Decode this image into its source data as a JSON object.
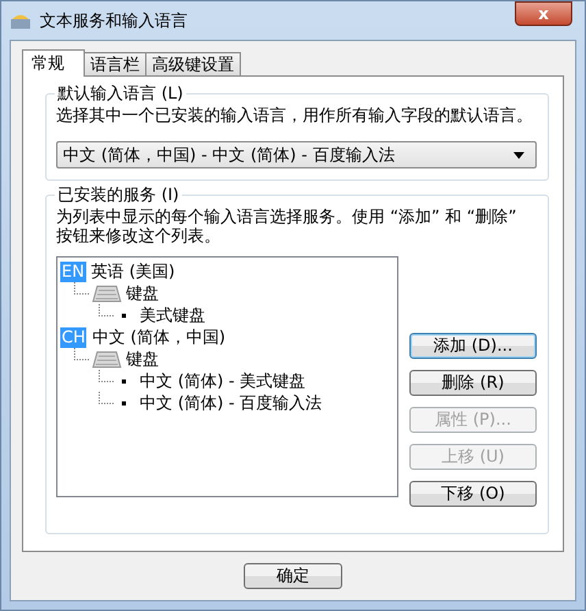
{
  "window": {
    "title": "文本服务和输入语言",
    "close_label": "x"
  },
  "tabs": [
    {
      "label": "常规",
      "selected": true
    },
    {
      "label": "语言栏",
      "selected": false
    },
    {
      "label": "高级键设置",
      "selected": false
    }
  ],
  "default_language": {
    "legend": "默认输入语言 (L)",
    "description": "选择其中一个已安装的输入语言，用作所有输入字段的默认语言。",
    "value": "中文 (简体，中国) - 中文 (简体) - 百度输入法"
  },
  "installed_services": {
    "legend": "已安装的服务 (I)",
    "description": "为列表中显示的每个输入语言选择服务。使用 “添加” 和 “删除” 按钮来修改这个列表。",
    "tree": [
      {
        "kind": "language",
        "badge": "EN",
        "label": "英语 (美国)",
        "children": [
          {
            "kind": "category",
            "label": "键盘",
            "children": [
              {
                "kind": "service",
                "label": "美式键盘"
              }
            ]
          }
        ]
      },
      {
        "kind": "language",
        "badge": "CH",
        "label": "中文 (简体，中国)",
        "children": [
          {
            "kind": "category",
            "label": "键盘",
            "children": [
              {
                "kind": "service",
                "label": "中文 (简体) - 美式键盘"
              },
              {
                "kind": "service",
                "label": "中文 (简体) - 百度输入法"
              }
            ]
          }
        ]
      }
    ],
    "buttons": [
      {
        "label": "添加 (D)...",
        "disabled": false,
        "focused": true
      },
      {
        "label": "删除 (R)",
        "disabled": false,
        "focused": false
      },
      {
        "label": "属性 (P)...",
        "disabled": true,
        "focused": false
      },
      {
        "label": "上移 (U)",
        "disabled": true,
        "focused": false
      },
      {
        "label": "下移 (O)",
        "disabled": false,
        "focused": false
      }
    ]
  },
  "footer_buttons": [
    {
      "label": "确定"
    }
  ]
}
